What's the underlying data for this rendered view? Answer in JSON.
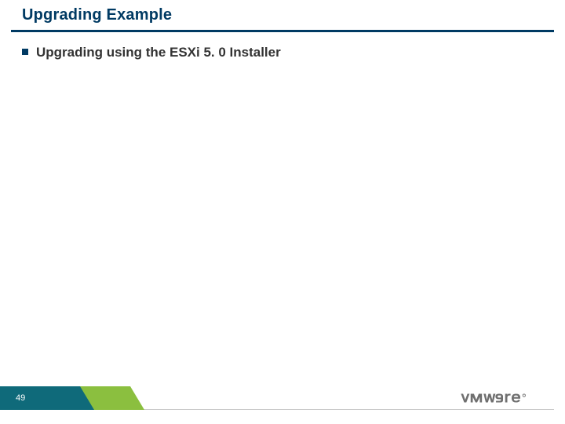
{
  "slide": {
    "title": "Upgrading Example",
    "bullets": [
      {
        "text": "Upgrading using the ESXi 5. 0 Installer"
      }
    ]
  },
  "footer": {
    "page_number": "49",
    "logo_name": "vmware",
    "colors": {
      "teal": "#0f6a7a",
      "green": "#8bbf3f",
      "navy": "#003a63"
    }
  }
}
